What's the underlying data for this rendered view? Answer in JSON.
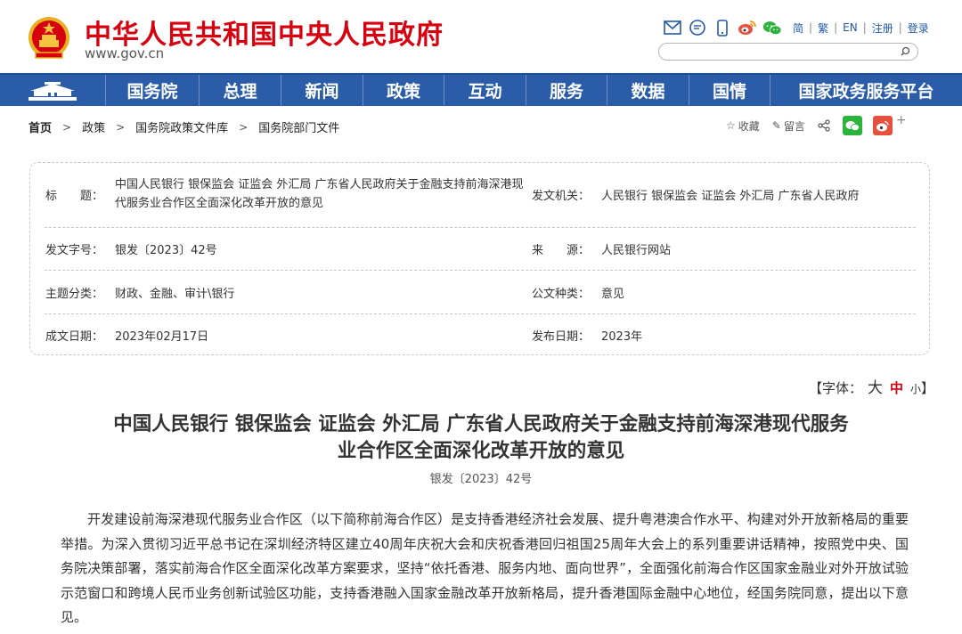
{
  "header": {
    "site_title": "中华人民共和国中央人民政府",
    "site_url": "www.gov.cn",
    "toolbar_icons": [
      "mail-icon",
      "message-icon",
      "mobile-icon",
      "weibo-icon",
      "wechat-icon"
    ],
    "lang": {
      "simplified": "简",
      "traditional": "繁",
      "english": "EN",
      "register": "注册",
      "login": "登录"
    },
    "search": {
      "placeholder": "",
      "value": ""
    }
  },
  "nav": {
    "items": [
      "国务院",
      "总理",
      "新闻",
      "政策",
      "互动",
      "服务",
      "数据",
      "国情",
      "国家政务服务平台"
    ]
  },
  "breadcrumb": {
    "items": [
      "首页",
      "政策",
      "国务院政策文件库",
      "国务院部门文件"
    ]
  },
  "share": {
    "favorite": "收藏",
    "comment": "留言",
    "plus": "+"
  },
  "meta": {
    "title_label": "标　　题：",
    "title_value": "中国人民银行 银保监会 证监会 外汇局 广东省人民政府关于金融支持前海深港现代服务业合作区全面深化改革开放的意见",
    "issuer_label": "发文机关：",
    "issuer_value": "人民银行 银保监会 证监会 外汇局 广东省人民政府",
    "doc_no_label": "发文字号：",
    "doc_no_value": "银发〔2023〕42号",
    "source_label": "来　　源：",
    "source_value": "人民银行网站",
    "topic_label": "主题分类：",
    "topic_value": "财政、金融、审计\\银行",
    "type_label": "公文种类：",
    "type_value": "意见",
    "created_label": "成文日期：",
    "created_value": "2023年02月17日",
    "published_label": "发布日期：",
    "published_value": "2023年"
  },
  "fontsize": {
    "prefix": "【字体：",
    "large": "大",
    "medium": "中",
    "small": "小",
    "suffix": "】"
  },
  "article": {
    "title_line1": "中国人民银行 银保监会 证监会 外汇局 广东省人民政府关于金融支持前海深港现代服务",
    "title_line2": "业合作区全面深化改革开放的意见",
    "doc_no": "银发〔2023〕42号",
    "body": "开发建设前海深港现代服务业合作区（以下简称前海合作区）是支持香港经济社会发展、提升粤港澳合作水平、构建对外开放新格局的重要举措。为深入贯彻习近平总书记在深圳经济特区建立40周年庆祝大会和庆祝香港回归祖国25周年大会上的系列重要讲话精神，按照党中央、国务院决策部署，落实前海合作区全面深化改革方案要求，坚持“依托香港、服务内地、面向世界”，全面强化前海合作区国家金融业对外开放试验示范窗口和跨境人民币业务创新试验区功能，支持香港融入国家金融改革开放新格局，提升香港国际金融中心地位，经国务院同意，提出以下意见。"
  },
  "colors": {
    "brand_red": "#d6000f",
    "nav_blue": "#2a5ca8",
    "wechat_green": "#2bb33b",
    "weibo_red": "#e6513f"
  }
}
